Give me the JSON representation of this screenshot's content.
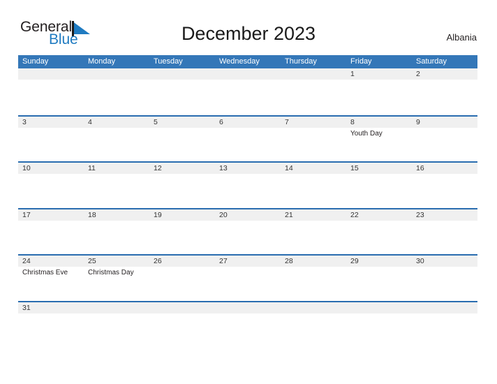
{
  "brand": {
    "name_part1": "General",
    "name_part2": "Blue",
    "flag_icon": "triangle-flag-icon",
    "color_dark": "#231f20",
    "color_blue": "#1f7bc1"
  },
  "header": {
    "title": "December 2023",
    "country": "Albania"
  },
  "theme": {
    "header_blue": "#3477b8",
    "row_line_blue": "#2a6db0",
    "band_gray": "#f0f0f0",
    "text_dark": "#333333"
  },
  "calendar": {
    "weekdays": [
      "Sunday",
      "Monday",
      "Tuesday",
      "Wednesday",
      "Thursday",
      "Friday",
      "Saturday"
    ],
    "weeks": [
      {
        "days": [
          {
            "number": "",
            "event": ""
          },
          {
            "number": "",
            "event": ""
          },
          {
            "number": "",
            "event": ""
          },
          {
            "number": "",
            "event": ""
          },
          {
            "number": "",
            "event": ""
          },
          {
            "number": "1",
            "event": ""
          },
          {
            "number": "2",
            "event": ""
          }
        ]
      },
      {
        "days": [
          {
            "number": "3",
            "event": ""
          },
          {
            "number": "4",
            "event": ""
          },
          {
            "number": "5",
            "event": ""
          },
          {
            "number": "6",
            "event": ""
          },
          {
            "number": "7",
            "event": ""
          },
          {
            "number": "8",
            "event": "Youth Day"
          },
          {
            "number": "9",
            "event": ""
          }
        ]
      },
      {
        "days": [
          {
            "number": "10",
            "event": ""
          },
          {
            "number": "11",
            "event": ""
          },
          {
            "number": "12",
            "event": ""
          },
          {
            "number": "13",
            "event": ""
          },
          {
            "number": "14",
            "event": ""
          },
          {
            "number": "15",
            "event": ""
          },
          {
            "number": "16",
            "event": ""
          }
        ]
      },
      {
        "days": [
          {
            "number": "17",
            "event": ""
          },
          {
            "number": "18",
            "event": ""
          },
          {
            "number": "19",
            "event": ""
          },
          {
            "number": "20",
            "event": ""
          },
          {
            "number": "21",
            "event": ""
          },
          {
            "number": "22",
            "event": ""
          },
          {
            "number": "23",
            "event": ""
          }
        ]
      },
      {
        "days": [
          {
            "number": "24",
            "event": "Christmas Eve"
          },
          {
            "number": "25",
            "event": "Christmas Day"
          },
          {
            "number": "26",
            "event": ""
          },
          {
            "number": "27",
            "event": ""
          },
          {
            "number": "28",
            "event": ""
          },
          {
            "number": "29",
            "event": ""
          },
          {
            "number": "30",
            "event": ""
          }
        ]
      },
      {
        "days": [
          {
            "number": "31",
            "event": ""
          },
          {
            "number": "",
            "event": ""
          },
          {
            "number": "",
            "event": ""
          },
          {
            "number": "",
            "event": ""
          },
          {
            "number": "",
            "event": ""
          },
          {
            "number": "",
            "event": ""
          },
          {
            "number": "",
            "event": ""
          }
        ]
      }
    ]
  }
}
